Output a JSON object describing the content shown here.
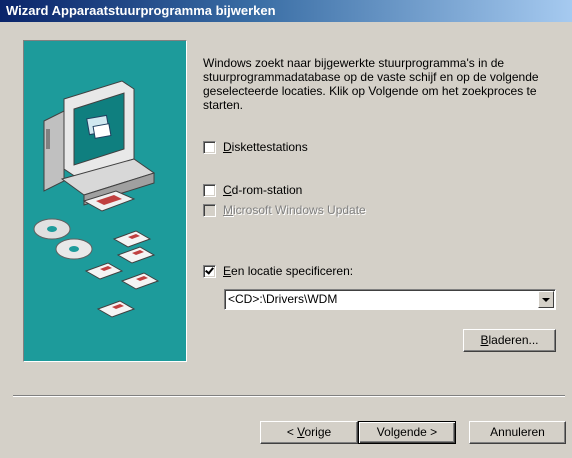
{
  "window": {
    "title": "Wizard Apparaatstuurprogramma bijwerken"
  },
  "intro_text": "Windows zoekt naar bijgewerkte stuurprogramma's in de stuurprogrammadatabase op de vaste schijf en op de volgende geselecteerde locaties. Klik op Volgende om het zoekproces te starten.",
  "options": {
    "diskette": {
      "accel": "D",
      "rest": "iskettestations",
      "checked": false,
      "enabled": true
    },
    "cdrom": {
      "accel": "C",
      "rest": "d-rom-station",
      "checked": false,
      "enabled": true
    },
    "windows_update": {
      "accel": "M",
      "rest": "icrosoft Windows Update",
      "checked": false,
      "enabled": false
    },
    "location": {
      "accel": "E",
      "rest": "en locatie specificeren:",
      "checked": true,
      "enabled": true
    }
  },
  "location_combo": {
    "value": "<CD>:\\Drivers\\WDM"
  },
  "buttons": {
    "browse": {
      "accel": "B",
      "rest": "laderen..."
    },
    "back": {
      "prefix": "< ",
      "accel": "V",
      "rest": "orige"
    },
    "next": "Volgende >",
    "cancel": "Annuleren"
  },
  "icons": {
    "illustration": "computer-with-discs-illustration",
    "combo_arrow": "chevron-down-icon"
  }
}
